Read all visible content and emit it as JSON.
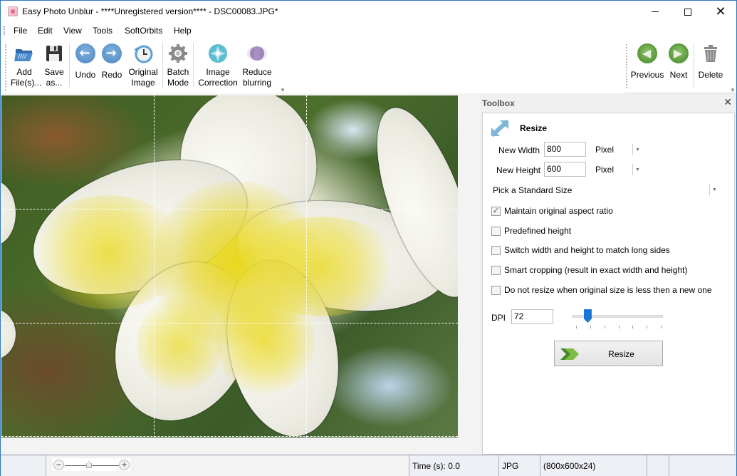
{
  "window": {
    "title": "Easy Photo Unblur - ****Unregistered version**** - DSC00083.JPG*",
    "controls": [
      "minimize",
      "maximize",
      "close"
    ]
  },
  "menu": {
    "items": [
      {
        "label": "File",
        "accel": "F"
      },
      {
        "label": "Edit",
        "accel": "E"
      },
      {
        "label": "View",
        "accel": "V"
      },
      {
        "label": "Tools",
        "accel": "T"
      },
      {
        "label": "SoftOrbits",
        "accel": ""
      },
      {
        "label": "Help",
        "accel": "H"
      }
    ]
  },
  "toolbar": {
    "left": [
      {
        "id": "add-files",
        "line1": "Add",
        "line2": "File(s)...",
        "icon": "open-folder-icon"
      },
      {
        "id": "save-as",
        "line1": "Save",
        "line2": "as...",
        "icon": "floppy-disk-icon"
      },
      {
        "id": "undo",
        "line1": "Undo",
        "line2": "",
        "icon": "undo-arrow-icon"
      },
      {
        "id": "redo",
        "line1": "Redo",
        "line2": "",
        "icon": "redo-arrow-icon"
      },
      {
        "id": "original-image",
        "line1": "Original",
        "line2": "Image",
        "icon": "clock-history-icon"
      },
      {
        "id": "batch-mode",
        "line1": "Batch",
        "line2": "Mode",
        "icon": "gear-icon"
      },
      {
        "id": "image-correction",
        "line1": "Image",
        "line2": "Correction",
        "icon": "correction-star-icon"
      },
      {
        "id": "reduce-blurring",
        "line1": "Reduce",
        "line2": "blurring",
        "icon": "blur-sphere-icon"
      }
    ],
    "right": [
      {
        "id": "previous",
        "label": "Previous",
        "icon": "previous-arrow-icon"
      },
      {
        "id": "next",
        "label": "Next",
        "icon": "next-arrow-icon"
      },
      {
        "id": "delete",
        "label": "Delete",
        "icon": "trash-icon"
      }
    ]
  },
  "toolbox": {
    "header": "Toolbox",
    "section_title": "Resize",
    "new_width_label": "New Width",
    "new_width_value": "800",
    "new_width_unit": "Pixel",
    "new_height_label": "New Height",
    "new_height_value": "600",
    "new_height_unit": "Pixel",
    "standard_size": "Pick a Standard Size",
    "checkboxes": [
      {
        "label": "Maintain original aspect ratio",
        "checked": true
      },
      {
        "label": "Predefined height",
        "checked": false
      },
      {
        "label": "Switch width and height to match long sides",
        "checked": false
      },
      {
        "label": "Smart cropping (result in exact width and height)",
        "checked": false
      },
      {
        "label": "Do not resize when original size is less then a new one",
        "checked": false
      }
    ],
    "dpi_label": "DPI",
    "dpi_value": "72",
    "dpi_slider_fraction": 0.14,
    "dpi_slider_ticks": 7,
    "resize_button": "Resize"
  },
  "statusbar": {
    "zoom_fraction": 0.45,
    "time": "Time (s): 0.0",
    "format": "JPG",
    "dimensions": "(800x600x24)"
  }
}
